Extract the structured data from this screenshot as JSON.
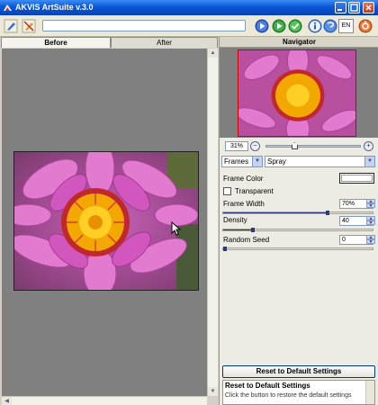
{
  "window": {
    "title": "AKVIS ArtSuite v.3.0"
  },
  "toolbar": {
    "language": "EN",
    "icons": [
      "brush-icon",
      "clear-brush-icon",
      "play-icon",
      "forward-icon",
      "apply-icon",
      "info-icon",
      "help-icon",
      "settings-icon"
    ]
  },
  "tabs": {
    "before": "Before",
    "after": "After"
  },
  "navigator": {
    "title": "Navigator",
    "zoom": "31%",
    "zoom_level": 0.31,
    "zoom_out": "−",
    "zoom_in": "+"
  },
  "settings": {
    "effect": "Frames",
    "frame_type": "Spray",
    "frame_color_label": "Frame Color",
    "frame_color": "#ffffff",
    "transparent_label": "Transparent",
    "transparent_checked": false,
    "frame_width_label": "Frame Width",
    "frame_width": "70%",
    "frame_width_value": 70,
    "density_label": "Density",
    "density": "40",
    "density_value": 40,
    "random_seed_label": "Random Seed",
    "random_seed": "0",
    "random_seed_value": 0
  },
  "reset_button": "Reset to Default Settings",
  "hint": {
    "title": "Reset to Default Settings",
    "body": "Click the button to restore the default settings"
  },
  "colors": {
    "titlebar": "#0a57d8",
    "canvas_bg": "#808080",
    "panel_bg": "#ecebe4",
    "slider_fill": "#2b3c77",
    "petal": "#c84fb4",
    "flower_center": "#f2a800"
  }
}
